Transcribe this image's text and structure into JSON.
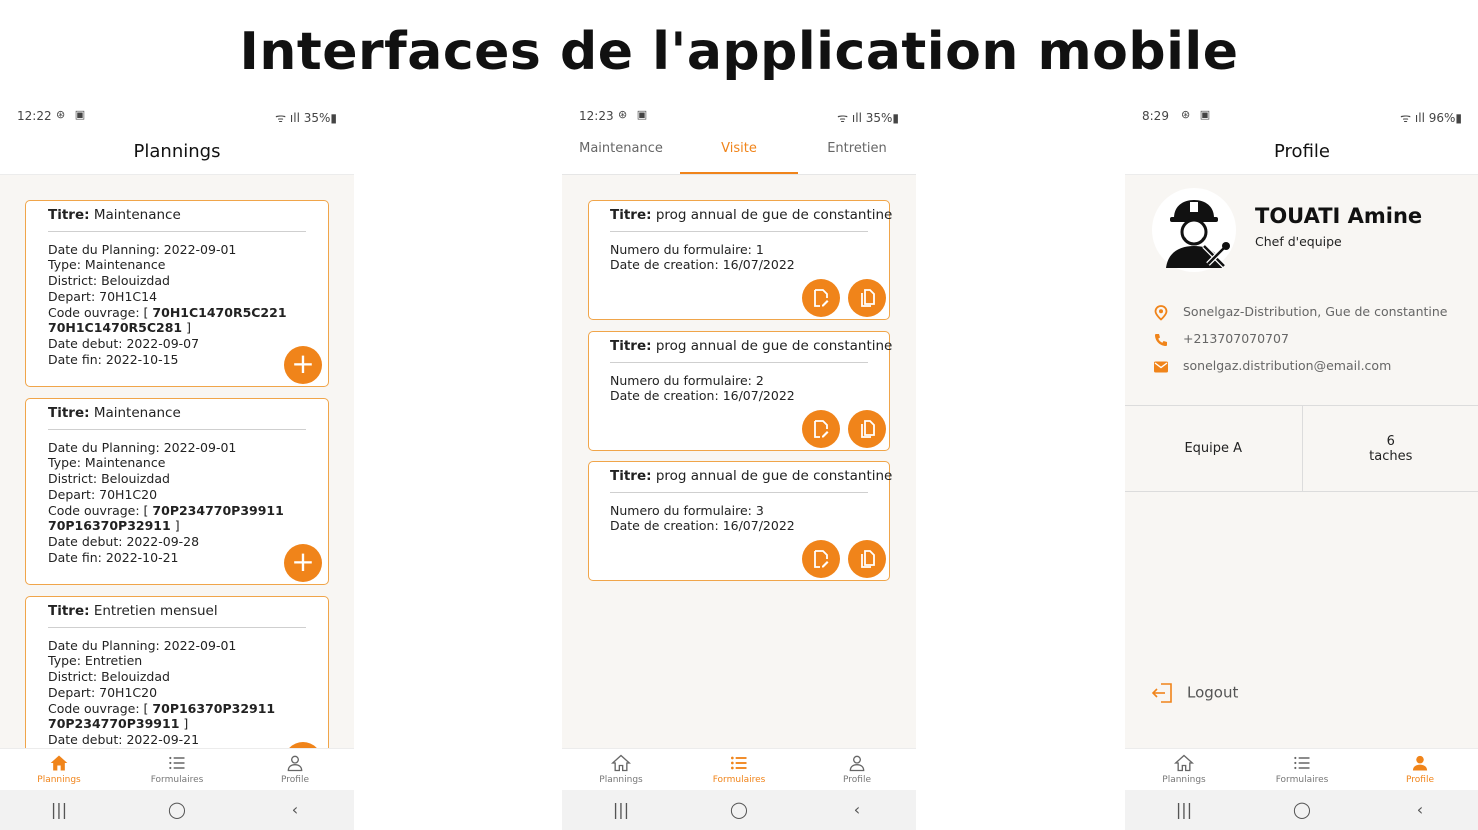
{
  "main_title": "Interfaces de l'application mobile",
  "colors": {
    "accent": "#f0841a",
    "card_border": "#f0a54a"
  },
  "phone1": {
    "status": {
      "time": "12:22",
      "battery": "35%"
    },
    "title": "Plannings",
    "labels": {
      "titre": "Titre:",
      "date_planning": "Date du Planning:",
      "type": "Type:",
      "district": "District:",
      "depart": "Depart:",
      "code": "Code ouvrage: [",
      "date_debut": "Date debut:",
      "date_fin": "Date fin:",
      "close": "]"
    },
    "cards": [
      {
        "titre": "Maintenance",
        "date_planning": "2022-09-01",
        "type": "Maintenance",
        "district": "Belouizdad",
        "depart": "70H1C14",
        "code1": "70H1C1470R5C221",
        "code2": "70H1C1470R5C281",
        "date_debut": "2022-09-07",
        "date_fin": "2022-10-15"
      },
      {
        "titre": "Maintenance",
        "date_planning": "2022-09-01",
        "type": "Maintenance",
        "district": "Belouizdad",
        "depart": "70H1C20",
        "code1": "70P234770P39911",
        "code2": "70P16370P32911",
        "date_debut": "2022-09-28",
        "date_fin": "2022-10-21"
      },
      {
        "titre": "Entretien mensuel",
        "date_planning": "2022-09-01",
        "type": "Entretien",
        "district": "Belouizdad",
        "depart": "70H1C20",
        "code1": "70P16370P32911",
        "code2": "70P234770P39911",
        "date_debut": "2022-09-21",
        "date_fin": ""
      }
    ]
  },
  "phone2": {
    "status": {
      "time": "12:23",
      "battery": "35%"
    },
    "tabs": [
      "Maintenance",
      "Visite",
      "Entretien"
    ],
    "labels": {
      "titre": "Titre:",
      "numero": "Numero du formulaire:",
      "date_creation": "Date de creation:"
    },
    "cards": [
      {
        "titre": "prog annual de gue de constantine",
        "numero": "1",
        "date_creation": "16/07/2022"
      },
      {
        "titre": "prog annual de gue de constantine",
        "numero": "2",
        "date_creation": "16/07/2022"
      },
      {
        "titre": "prog annual de gue de constantine",
        "numero": "3",
        "date_creation": "16/07/2022"
      }
    ]
  },
  "phone3": {
    "status": {
      "time": "8:29",
      "battery": "96%"
    },
    "title": "Profile",
    "name": "TOUATI Amine",
    "role": "Chef d'equipe",
    "address": "Sonelgaz-Distribution, Gue de constantine",
    "phone": "+213707070707",
    "email": "sonelgaz.distribution@email.com",
    "team": "Equipe A",
    "tasks_count": "6",
    "tasks_label": "taches",
    "logout": "Logout"
  },
  "nav": {
    "plannings": "Plannings",
    "formulaires": "Formulaires",
    "profile": "Profile"
  }
}
